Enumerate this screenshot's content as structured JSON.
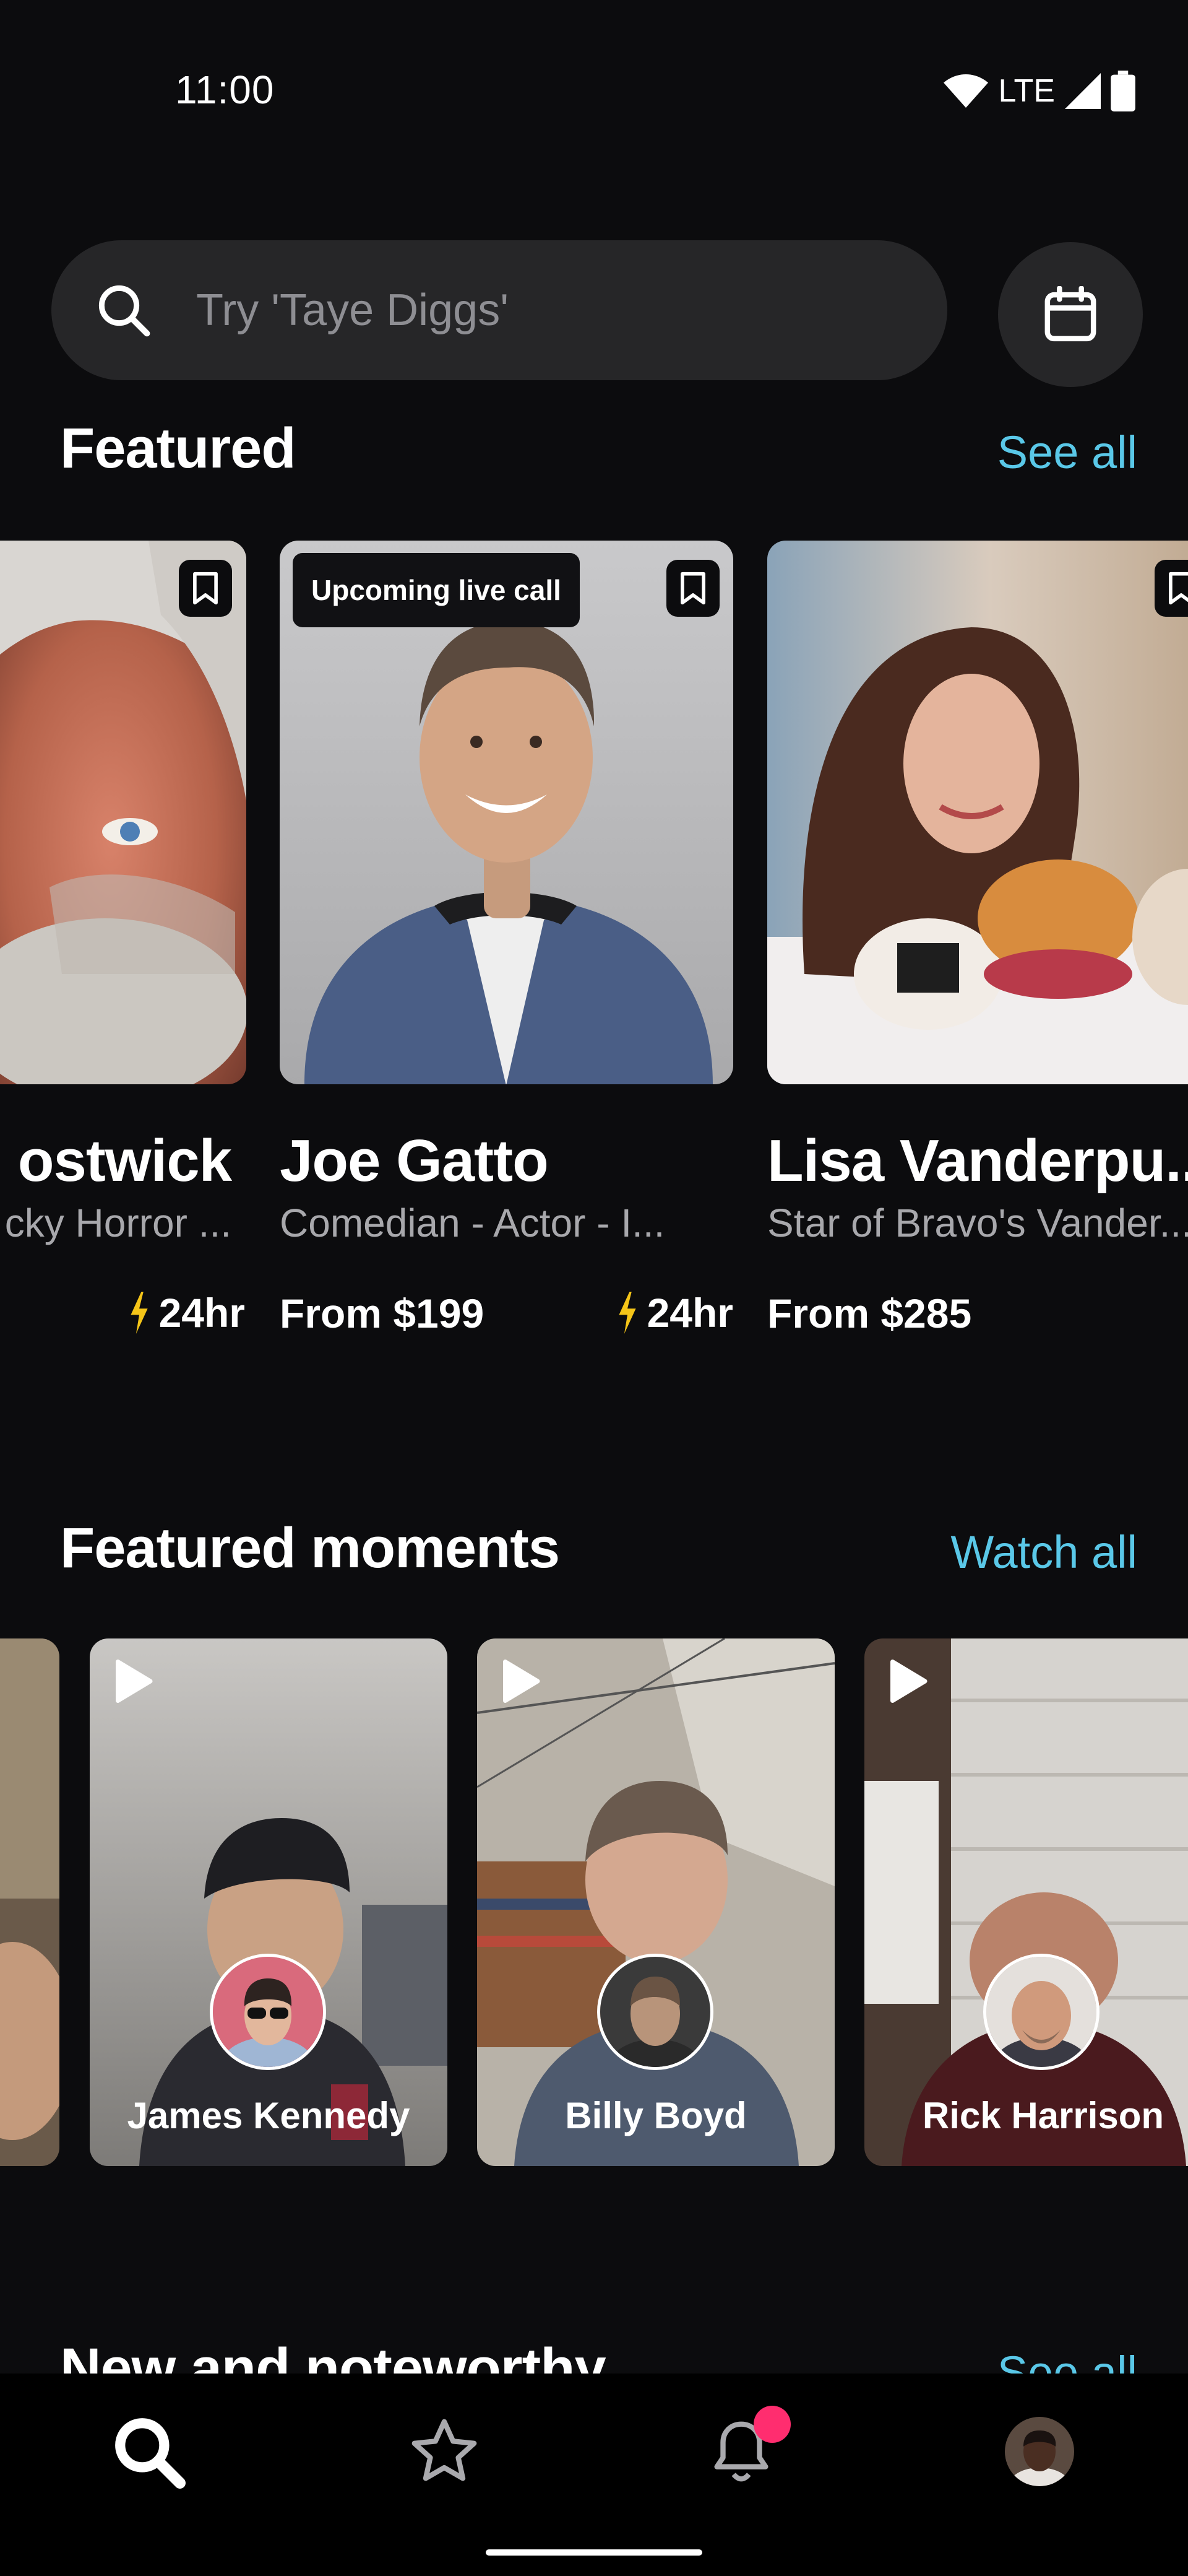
{
  "status_bar": {
    "time": "11:00",
    "network": "LTE"
  },
  "search": {
    "placeholder": "Try 'Taye Diggs'"
  },
  "featured": {
    "title": "Featured",
    "see_all": "See all",
    "cards": [
      {
        "name": "ostwick",
        "subtitle": "cky Horror ...",
        "speed": "24hr",
        "price": ""
      },
      {
        "name": "Joe Gatto",
        "subtitle": "Comedian - Actor - I...",
        "badge": "Upcoming live call",
        "price": "From $199",
        "speed": "24hr"
      },
      {
        "name": "Lisa Vanderpu...",
        "subtitle": "Star of Bravo's Vander...",
        "price": "From $285"
      }
    ]
  },
  "moments": {
    "title": "Featured moments",
    "watch_all": "Watch all",
    "items": [
      {
        "name": "James Kennedy"
      },
      {
        "name": "Billy Boyd"
      },
      {
        "name": "Rick Harrison"
      }
    ]
  },
  "noteworthy": {
    "title": "New and noteworthy",
    "see_all": "See all"
  },
  "bottom_nav": {
    "items": [
      "search-icon",
      "star-icon",
      "bell-icon",
      "profile-avatar"
    ],
    "notification_dot_color": "#ff2d6f"
  },
  "colors": {
    "accent": "#5ac8e8",
    "background": "#0c0c0e",
    "bolt": "#f5c518"
  }
}
